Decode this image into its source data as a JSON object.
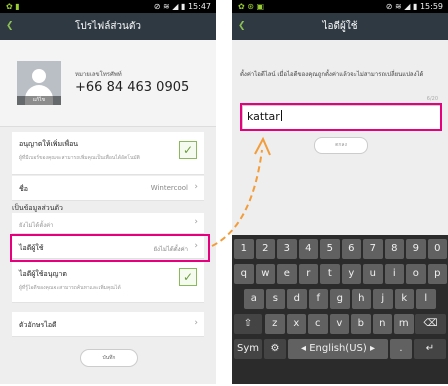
{
  "left_screen": {
    "status": {
      "time": "15:47",
      "icons": "✿ ▮",
      "signal": "⊘ ≋ ◢ ▮"
    },
    "title": "โปรไฟล์ส่วนตัว",
    "profile": {
      "phone_label": "หมายเลขโทรศัพท์",
      "phone_number": "+66 84 463 0905",
      "avatar_caption": "แก้ไข"
    },
    "allow_toggle": {
      "label": "อนุญาตให้เพิ่มเพื่อน",
      "note": "ผู้ที่มีเบอร์ของคุณจะสามารถเพิ่มคุณเป็นเพื่อนได้อัตโนมัติ"
    },
    "name_row": {
      "label": "ชื่อ",
      "value": "Wintercool"
    },
    "section_header": "เป็นข้อมูลส่วนตัว",
    "status_row": {
      "placeholder": "ยังไม่ได้ตั้งค่า"
    },
    "id_row": {
      "label": "ไอดีผู้ใช้",
      "value": "ยังไม่ได้ตั้งค่า"
    },
    "allow_id_row": {
      "label": "ไอดีผู้ใช้อนุญาต",
      "note": "ผู้ที่รู้ไอดีของคุณจะสามารถค้นหาและเพิ่มคุณได้"
    },
    "theme_row": {
      "label": "ตัวอักษรไอดี"
    },
    "save_button": "บันทึก"
  },
  "right_screen": {
    "status": {
      "time": "15:59",
      "icons": "✿ ⊛ ▣",
      "signal": "⊘ ≋ ◢ ▮"
    },
    "title": "ไอดีผู้ใช้",
    "instruction": "ตั้งค่าไอดีไลน์ เมื่อไอดีของคุณถูกตั้งค่าแล้วจะไม่สามารถเปลี่ยนแปลงได้",
    "counter": "6/20",
    "input_value": "kattar",
    "ok_button": "ตกลง",
    "keyboard": {
      "row1": [
        "1",
        "2",
        "3",
        "4",
        "5",
        "6",
        "7",
        "8",
        "9",
        "0"
      ],
      "row2": [
        "q",
        "w",
        "e",
        "r",
        "t",
        "y",
        "u",
        "i",
        "o",
        "p"
      ],
      "row3": [
        "a",
        "s",
        "d",
        "f",
        "g",
        "h",
        "j",
        "k",
        "l"
      ],
      "row4": [
        "z",
        "x",
        "c",
        "v",
        "b",
        "n",
        "m"
      ],
      "shift": "⇧",
      "delete": "⌫",
      "sym": "Sym",
      "settings": "⚙",
      "space": "◂ English(US) ▸",
      "period": ".",
      "enter": "↵"
    }
  },
  "colors": {
    "highlight": "#e6007e",
    "arrow": "#f39c3a",
    "titlebar": "#2f3942",
    "check": "#6a9e3c"
  }
}
